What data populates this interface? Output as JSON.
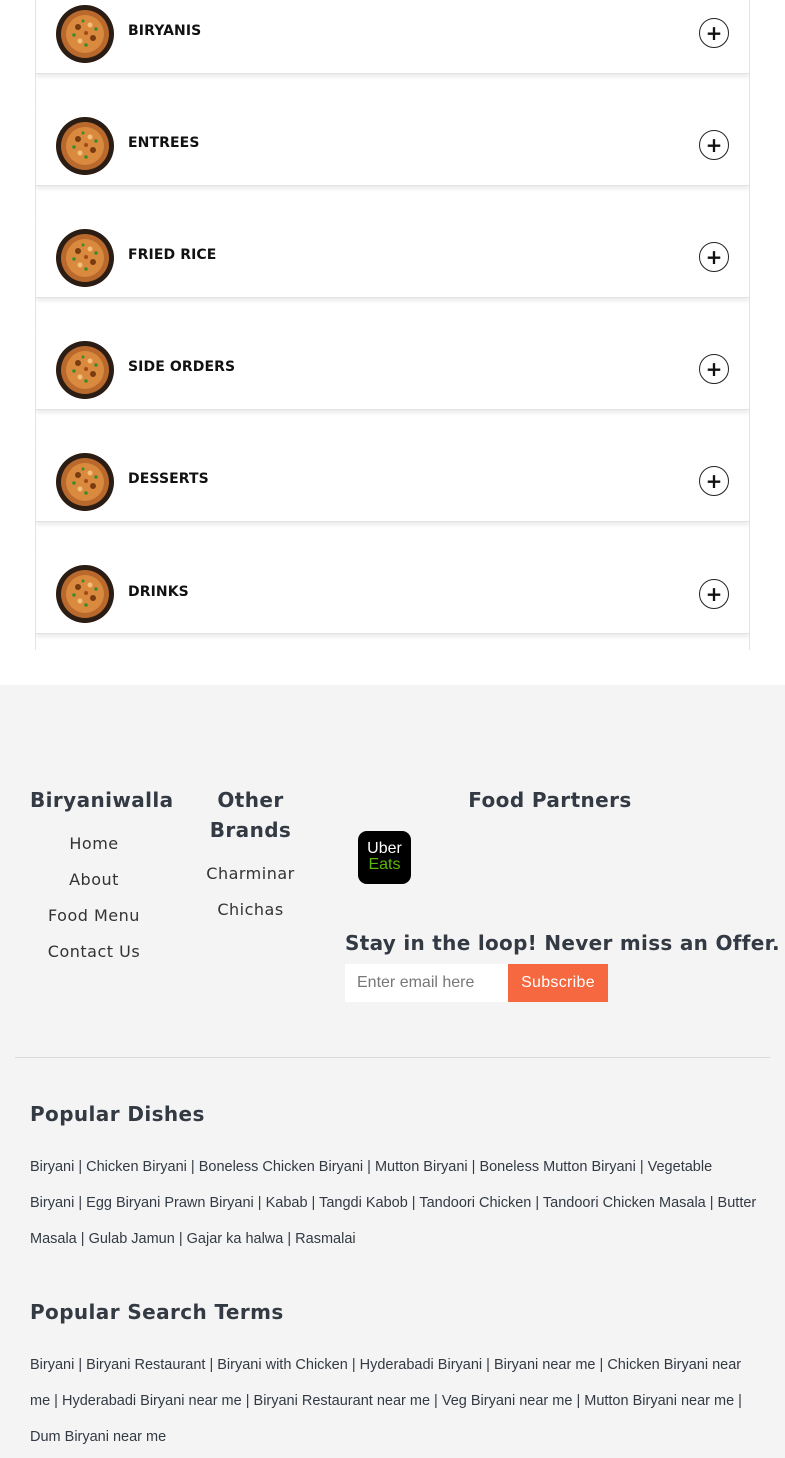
{
  "menu": {
    "categories": [
      {
        "label": "BIRYANIS"
      },
      {
        "label": "ENTREES"
      },
      {
        "label": "FRIED RICE"
      },
      {
        "label": "SIDE ORDERS"
      },
      {
        "label": "DESSERTS"
      },
      {
        "label": "DRINKS"
      }
    ],
    "expand_icon": "+"
  },
  "footer": {
    "brand": {
      "title": "Biryaniwalla",
      "links": [
        "Home",
        "About",
        "Food Menu",
        "Contact Us"
      ]
    },
    "other_brands": {
      "title_line1": "Other",
      "title_line2": "Brands",
      "links": [
        "Charminar",
        "Chichas"
      ]
    },
    "food_partners": {
      "title": "Food Partners",
      "partner_logo_line1": "Uber",
      "partner_logo_line2": "Eats"
    },
    "newsletter": {
      "title": "Stay in the loop! Never miss an Offer.",
      "placeholder": "Enter email here",
      "button": "Subscribe"
    },
    "popular_dishes": {
      "title": "Popular Dishes",
      "text": "Biryani | Chicken Biryani | Boneless Chicken Biryani | Mutton Biryani | Boneless Mutton Biryani | Vegetable Biryani | Egg Biryani Prawn Biryani | Kabab | Tangdi Kabob | Tandoori Chicken | Tandoori Chicken Masala | Butter Masala | Gulab Jamun | Gajar ka halwa | Rasmalai"
    },
    "popular_search": {
      "title": "Popular Search Terms",
      "text": "Biryani | Biryani Restaurant | Biryani with Chicken | Hyderabadi Biryani | Biryani near me | Chicken Biryani near me | Hyderabadi Biryani near me | Biryani Restaurant near me | Veg Biryani near me | Mutton Biryani near me | Dum Biryani near me"
    }
  },
  "colors": {
    "accent": "#f6683f",
    "footer_bg": "#f4f4f4",
    "heading": "#333a44",
    "uber_green": "#5fb709"
  }
}
